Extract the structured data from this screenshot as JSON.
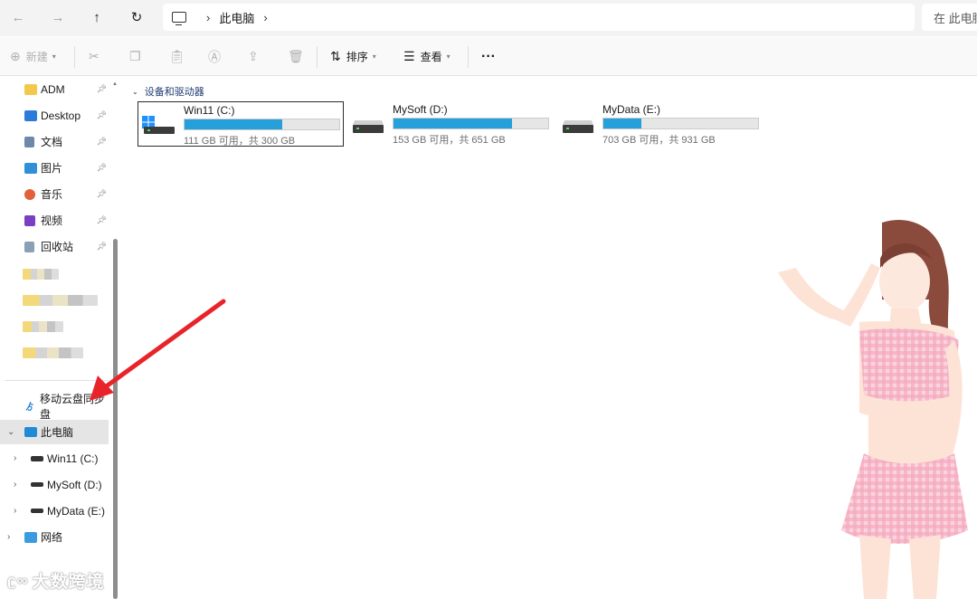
{
  "address": {
    "crumbs": [
      "此电脑"
    ],
    "search_placeholder": "在 此电脑"
  },
  "toolbar": {
    "new_label": "新建",
    "sort_label": "排序",
    "view_label": "查看",
    "more_label": "···"
  },
  "sidebar": {
    "pinned": [
      {
        "label": "ADM",
        "icon": "folder-icon",
        "color": "#f2c94c"
      },
      {
        "label": "Desktop",
        "icon": "desktop-icon",
        "color": "#2b7bd9"
      },
      {
        "label": "文档",
        "icon": "document-icon",
        "color": "#6c8aa8"
      },
      {
        "label": "图片",
        "icon": "pictures-icon",
        "color": "#2f8fd8"
      },
      {
        "label": "音乐",
        "icon": "music-icon",
        "color": "#e2603a"
      },
      {
        "label": "视频",
        "icon": "video-icon",
        "color": "#7a3fc2"
      },
      {
        "label": "回收站",
        "icon": "recycle-bin-icon",
        "color": "#8aa0b4"
      }
    ],
    "cloud": "移动云盘同步盘",
    "this_pc": "此电脑",
    "drives": [
      "Win11 (C:)",
      "MySoft (D:)",
      "MyData (E:)"
    ],
    "network": "网络"
  },
  "content": {
    "group_title": "设备和驱动器",
    "drives": [
      {
        "name": "Win11 (C:)",
        "capacity": "111 GB 可用，共 300 GB",
        "used_fraction": 0.63,
        "selected": true
      },
      {
        "name": "MySoft (D:)",
        "capacity": "153 GB 可用，共 651 GB",
        "used_fraction": 0.765,
        "selected": false
      },
      {
        "name": "MyData (E:)",
        "capacity": "703 GB 可用，共 931 GB",
        "used_fraction": 0.245,
        "selected": false
      }
    ]
  },
  "watermark": "大数跨境",
  "colors": {
    "accent": "#26a0da",
    "arrow": "#e8232a"
  }
}
